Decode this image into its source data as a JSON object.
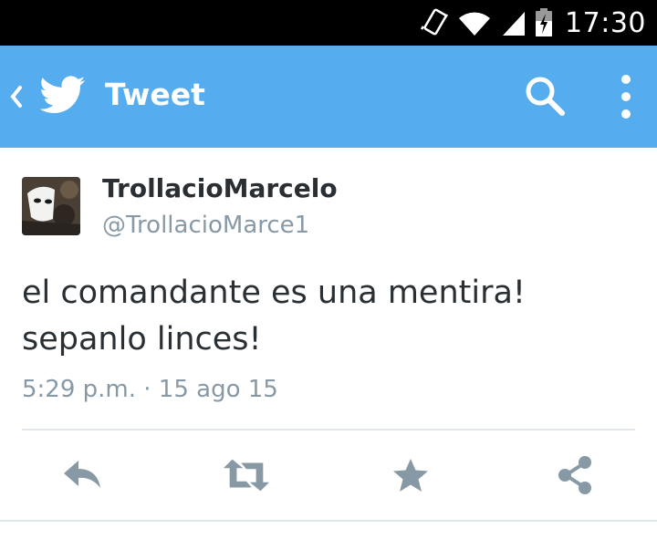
{
  "status_bar": {
    "time": "17:30",
    "icons": [
      "vibrate-icon",
      "wifi-icon",
      "signal-icon",
      "battery-charging-icon"
    ]
  },
  "app_bar": {
    "title": "Tweet",
    "back_icon": "chevron-left-icon",
    "logo_icon": "twitter-bird-icon",
    "search_icon": "search-icon",
    "overflow_icon": "more-vert-icon",
    "color": "#55acee"
  },
  "tweet": {
    "display_name": "TrollacioMarcelo",
    "handle": "@TrollacioMarce1",
    "text": "el comandante es una mentira!\nsepanlo linces!",
    "timestamp": "5:29 p.m. · 15 ago 15"
  },
  "actions": [
    "reply-icon",
    "retweet-icon",
    "favorite-star-icon",
    "share-icon"
  ],
  "colors": {
    "text_primary": "#292f33",
    "text_secondary": "#8899a6",
    "action_icon": "#8899a6",
    "divider": "#e1e8ed"
  }
}
